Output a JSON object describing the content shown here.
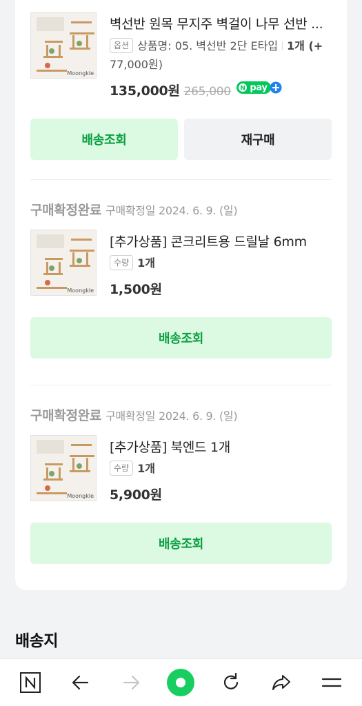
{
  "items": [
    {
      "title": "벽선반 원목 무지주 벽걸이 나무 선반 ...",
      "option_chip": "옵션",
      "option_text": "상품명: 05. 벽선반 2단 E타입",
      "quantity": "1개 (+",
      "quantity_extra": "77,000원)",
      "price": "135,000원",
      "original_price": "265,000",
      "thumb_label": "Moongkle",
      "buttons": [
        "배송조회",
        "재구매"
      ]
    },
    {
      "status": "구매확정완료",
      "status_date": "구매확정일 2024. 6. 9. (일)",
      "title": "[추가상품] 콘크리트용 드릴날 6mm",
      "option_chip": "수량",
      "quantity": "1개",
      "price": "1,500원",
      "thumb_label": "Moongkle",
      "buttons": [
        "배송조회"
      ]
    },
    {
      "status": "구매확정완료",
      "status_date": "구매확정일 2024. 6. 9. (일)",
      "title": "[추가상품] 북엔드 1개",
      "option_chip": "수량",
      "quantity": "1개",
      "price": "5,900원",
      "thumb_label": "Moongkle",
      "buttons": [
        "배송조회"
      ]
    }
  ],
  "npay": {
    "text": "pay",
    "color": "#03c75a"
  },
  "section_title": "배송지",
  "bottom_nav": [
    "naver-home-icon",
    "back-arrow-icon",
    "forward-arrow-icon",
    "green-dot-icon",
    "refresh-icon",
    "share-icon",
    "menu-icon"
  ],
  "colors": {
    "accent_green": "#0aa041",
    "button_green_bg": "#dcf9e2",
    "nav_green": "#19ce60"
  }
}
